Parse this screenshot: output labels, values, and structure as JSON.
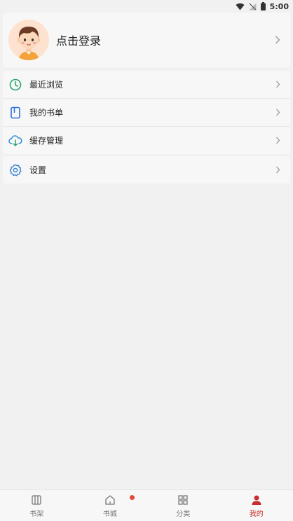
{
  "status_bar": {
    "time": "5:00",
    "icons": [
      "wifi-icon",
      "signal-off-icon",
      "battery-icon"
    ]
  },
  "profile": {
    "login_label": "点击登录",
    "avatar_icon": "avatar-icon"
  },
  "menu": {
    "items": [
      {
        "label": "最近浏览",
        "icon": "clock-icon",
        "color": "#2aa66a"
      },
      {
        "label": "我的书单",
        "icon": "book-icon",
        "color": "#2f6fe0"
      },
      {
        "label": "缓存管理",
        "icon": "cloud-download-icon",
        "color": "#2f8fd8"
      }
    ],
    "settings": {
      "label": "设置",
      "icon": "gear-icon",
      "color": "#2f7fd0"
    }
  },
  "tabbar": {
    "tabs": [
      {
        "label": "书架",
        "icon": "bookshelf-icon"
      },
      {
        "label": "书城",
        "icon": "home-icon",
        "badge": true
      },
      {
        "label": "分类",
        "icon": "grid-icon"
      },
      {
        "label": "我的",
        "icon": "person-icon",
        "active": true
      }
    ],
    "active_color": "#c62f2f",
    "badge_color": "#e04a3a"
  }
}
